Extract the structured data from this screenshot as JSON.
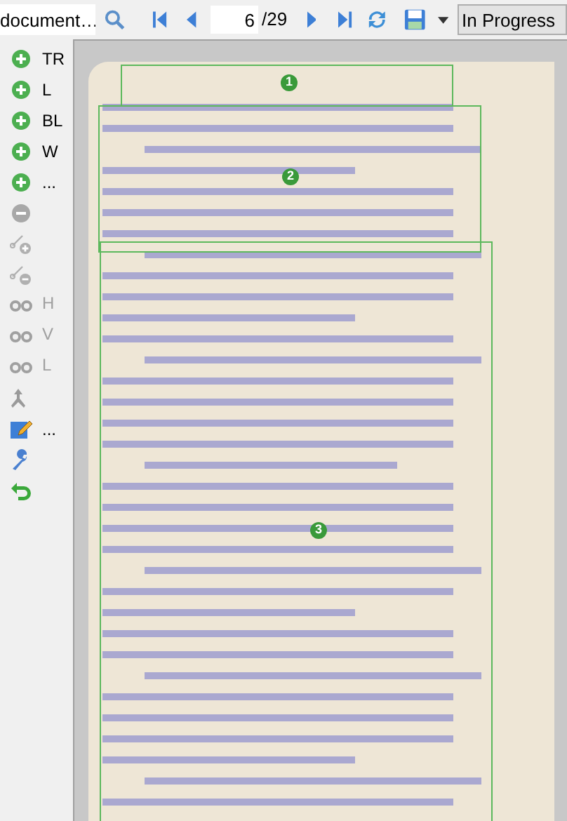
{
  "toolbar": {
    "document_field": {
      "value": "document…"
    },
    "page_field": {
      "value": "6"
    },
    "page_total": "/29",
    "status": {
      "value": "In Progress"
    }
  },
  "sidebar": {
    "tools": [
      {
        "kind": "add",
        "label": "TR",
        "disabled": false
      },
      {
        "kind": "add",
        "label": "L",
        "disabled": false
      },
      {
        "kind": "add",
        "label": "BL",
        "disabled": false
      },
      {
        "kind": "add",
        "label": "W",
        "disabled": false
      },
      {
        "kind": "add",
        "label": "...",
        "disabled": false
      },
      {
        "kind": "remove",
        "disabled": true
      },
      {
        "kind": "add-point",
        "disabled": true
      },
      {
        "kind": "remove-point",
        "disabled": true
      },
      {
        "kind": "link",
        "label": "H",
        "disabled": true
      },
      {
        "kind": "link",
        "label": "V",
        "disabled": true
      },
      {
        "kind": "link",
        "label": "L",
        "disabled": true
      },
      {
        "kind": "merge",
        "disabled": true
      },
      {
        "kind": "edit",
        "label": "...",
        "disabled": false
      },
      {
        "kind": "wrench",
        "disabled": false
      },
      {
        "kind": "undo",
        "disabled": false
      }
    ]
  },
  "regions": [
    {
      "number": "1"
    },
    {
      "number": "2"
    },
    {
      "number": "3"
    }
  ]
}
